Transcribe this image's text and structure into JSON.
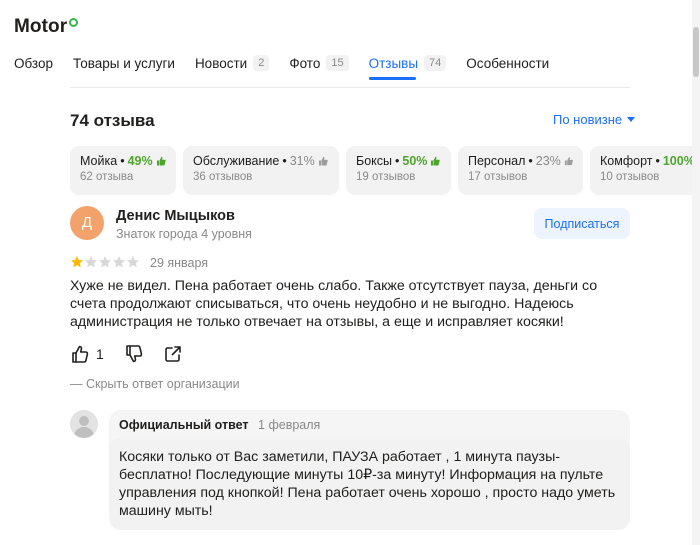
{
  "header": {
    "title": "Motor"
  },
  "tabs": [
    {
      "label": "Обзор",
      "count": null
    },
    {
      "label": "Товары и услуги",
      "count": null
    },
    {
      "label": "Новости",
      "count": "2"
    },
    {
      "label": "Фото",
      "count": "15"
    },
    {
      "label": "Отзывы",
      "count": "74",
      "active": true
    },
    {
      "label": "Особенности",
      "count": null
    }
  ],
  "reviews": {
    "count_title": "74 отзыва",
    "sort_label": "По новизне"
  },
  "aspects": [
    {
      "name": "Мойка",
      "percent": "49%",
      "sentiment": "good",
      "reviews": "62 отзыва"
    },
    {
      "name": "Обслуживание",
      "percent": "31%",
      "sentiment": "neutral",
      "reviews": "36 отзывов"
    },
    {
      "name": "Боксы",
      "percent": "50%",
      "sentiment": "good",
      "reviews": "19 отзывов"
    },
    {
      "name": "Персонал",
      "percent": "23%",
      "sentiment": "neutral",
      "reviews": "17 отзывов"
    },
    {
      "name": "Комфорт",
      "percent": "100%",
      "sentiment": "good",
      "reviews": "10 отзывов"
    }
  ],
  "review": {
    "avatar_letter": "Д",
    "author": "Денис Мыцыков",
    "level": "Знаток города 4 уровня",
    "subscribe_label": "Подписаться",
    "rating": 1,
    "rating_max": 5,
    "date": "29 января",
    "text": "Хуже не видел. Пена работает очень слабо. Также отсутствует пауза, деньги со счета продолжают списываться, что очень неудобно и не выгодно. Надеюсь администрация не только отвечает на отзывы, а еще и исправляет косяки!",
    "likes": "1",
    "hide_answer_label": "—  Скрыть ответ организации"
  },
  "answer": {
    "label": "Официальный ответ",
    "date": "1 февраля",
    "text": "Косяки только от Вас заметили, ПАУЗА работает , 1 минута паузы-бесплатно! Последующие минуты 10₽-за минуту! Информация на пульте управления под кнопкой! Пена работает очень хорошо , просто надо уметь машину мыть!"
  },
  "colors": {
    "accent": "#196dff",
    "good": "#4da62c",
    "star_filled": "#fcb800",
    "star_empty": "#d8d8d8",
    "avatar_bg": "#f4a26b"
  }
}
